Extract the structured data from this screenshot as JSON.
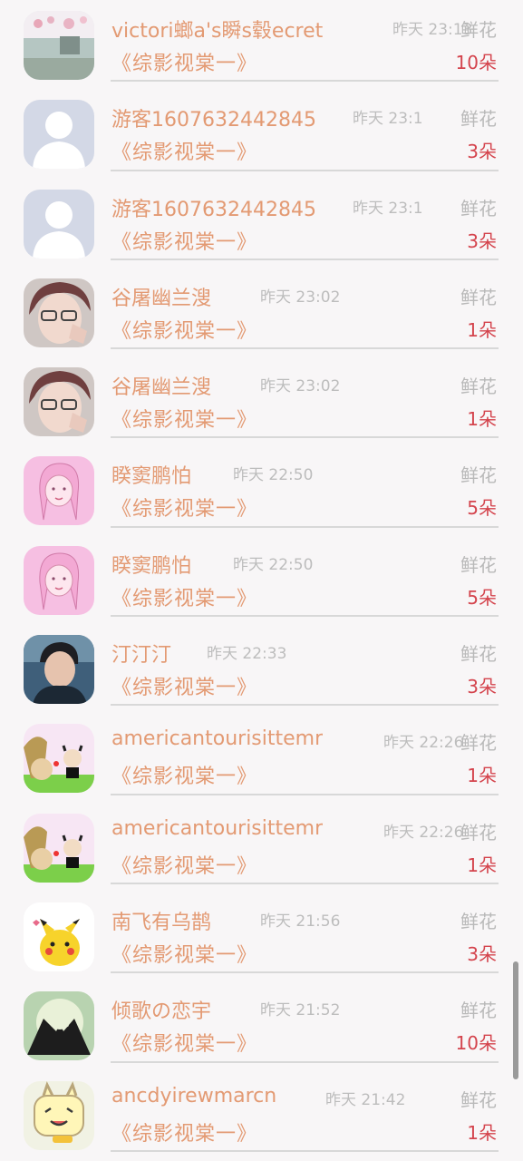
{
  "items": [
    {
      "name": "victori螂a's瞬s毂ecret",
      "time": "昨天 23:13",
      "gift": "鲜花",
      "book": "《综影视棠一》",
      "count": "10朵",
      "avatar": "landscape-photo"
    },
    {
      "name": "游客1607632442845",
      "time": "昨天 23:1",
      "gift": "鲜花",
      "book": "《综影视棠一》",
      "count": "3朵",
      "avatar": "default-user"
    },
    {
      "name": "游客1607632442845",
      "time": "昨天 23:1",
      "gift": "鲜花",
      "book": "《综影视棠一》",
      "count": "3朵",
      "avatar": "default-user"
    },
    {
      "name": "谷屠幽兰溲",
      "time": "昨天 23:02",
      "gift": "鲜花",
      "book": "《综影视棠一》",
      "count": "1朵",
      "avatar": "anime-glasses-boy"
    },
    {
      "name": "谷屠幽兰溲",
      "time": "昨天 23:02",
      "gift": "鲜花",
      "book": "《综影视棠一》",
      "count": "1朵",
      "avatar": "anime-glasses-boy"
    },
    {
      "name": "睽窦鹏怕",
      "time": "昨天 22:50",
      "gift": "鲜花",
      "book": "《综影视棠一》",
      "count": "5朵",
      "avatar": "pink-girl-sketch"
    },
    {
      "name": "睽窦鹏怕",
      "time": "昨天 22:50",
      "gift": "鲜花",
      "book": "《综影视棠一》",
      "count": "5朵",
      "avatar": "pink-girl-sketch"
    },
    {
      "name": "汀汀汀",
      "time": "昨天 22:33",
      "gift": "鲜花",
      "book": "《综影视棠一》",
      "count": "3朵",
      "avatar": "young-man-photo"
    },
    {
      "name": "americantourisittemr",
      "time": "昨天 22:26",
      "gift": "鲜花",
      "book": "《综影视棠一》",
      "count": "1朵",
      "avatar": "cartoon-kids"
    },
    {
      "name": "americantourisittemr",
      "time": "昨天 22:26",
      "gift": "鲜花",
      "book": "《综影视棠一》",
      "count": "1朵",
      "avatar": "cartoon-kids"
    },
    {
      "name": "南飞有乌鹊",
      "time": "昨天 21:56",
      "gift": "鲜花",
      "book": "《综影视棠一》",
      "count": "3朵",
      "avatar": "pikachu"
    },
    {
      "name": "倾歌の恋宇",
      "time": "昨天 21:52",
      "gift": "鲜花",
      "book": "《综影视棠一》",
      "count": "10朵",
      "avatar": "heart-hands-silhouette"
    },
    {
      "name": "ancdyirewmarcn",
      "time": "昨天 21:42",
      "gift": "鲜花",
      "book": "《综影视棠一》",
      "count": "1朵",
      "avatar": "cartoon-toast"
    }
  ],
  "colors": {
    "name": "#e39a73",
    "count": "#d4444d",
    "muted": "#bdbdbd"
  }
}
